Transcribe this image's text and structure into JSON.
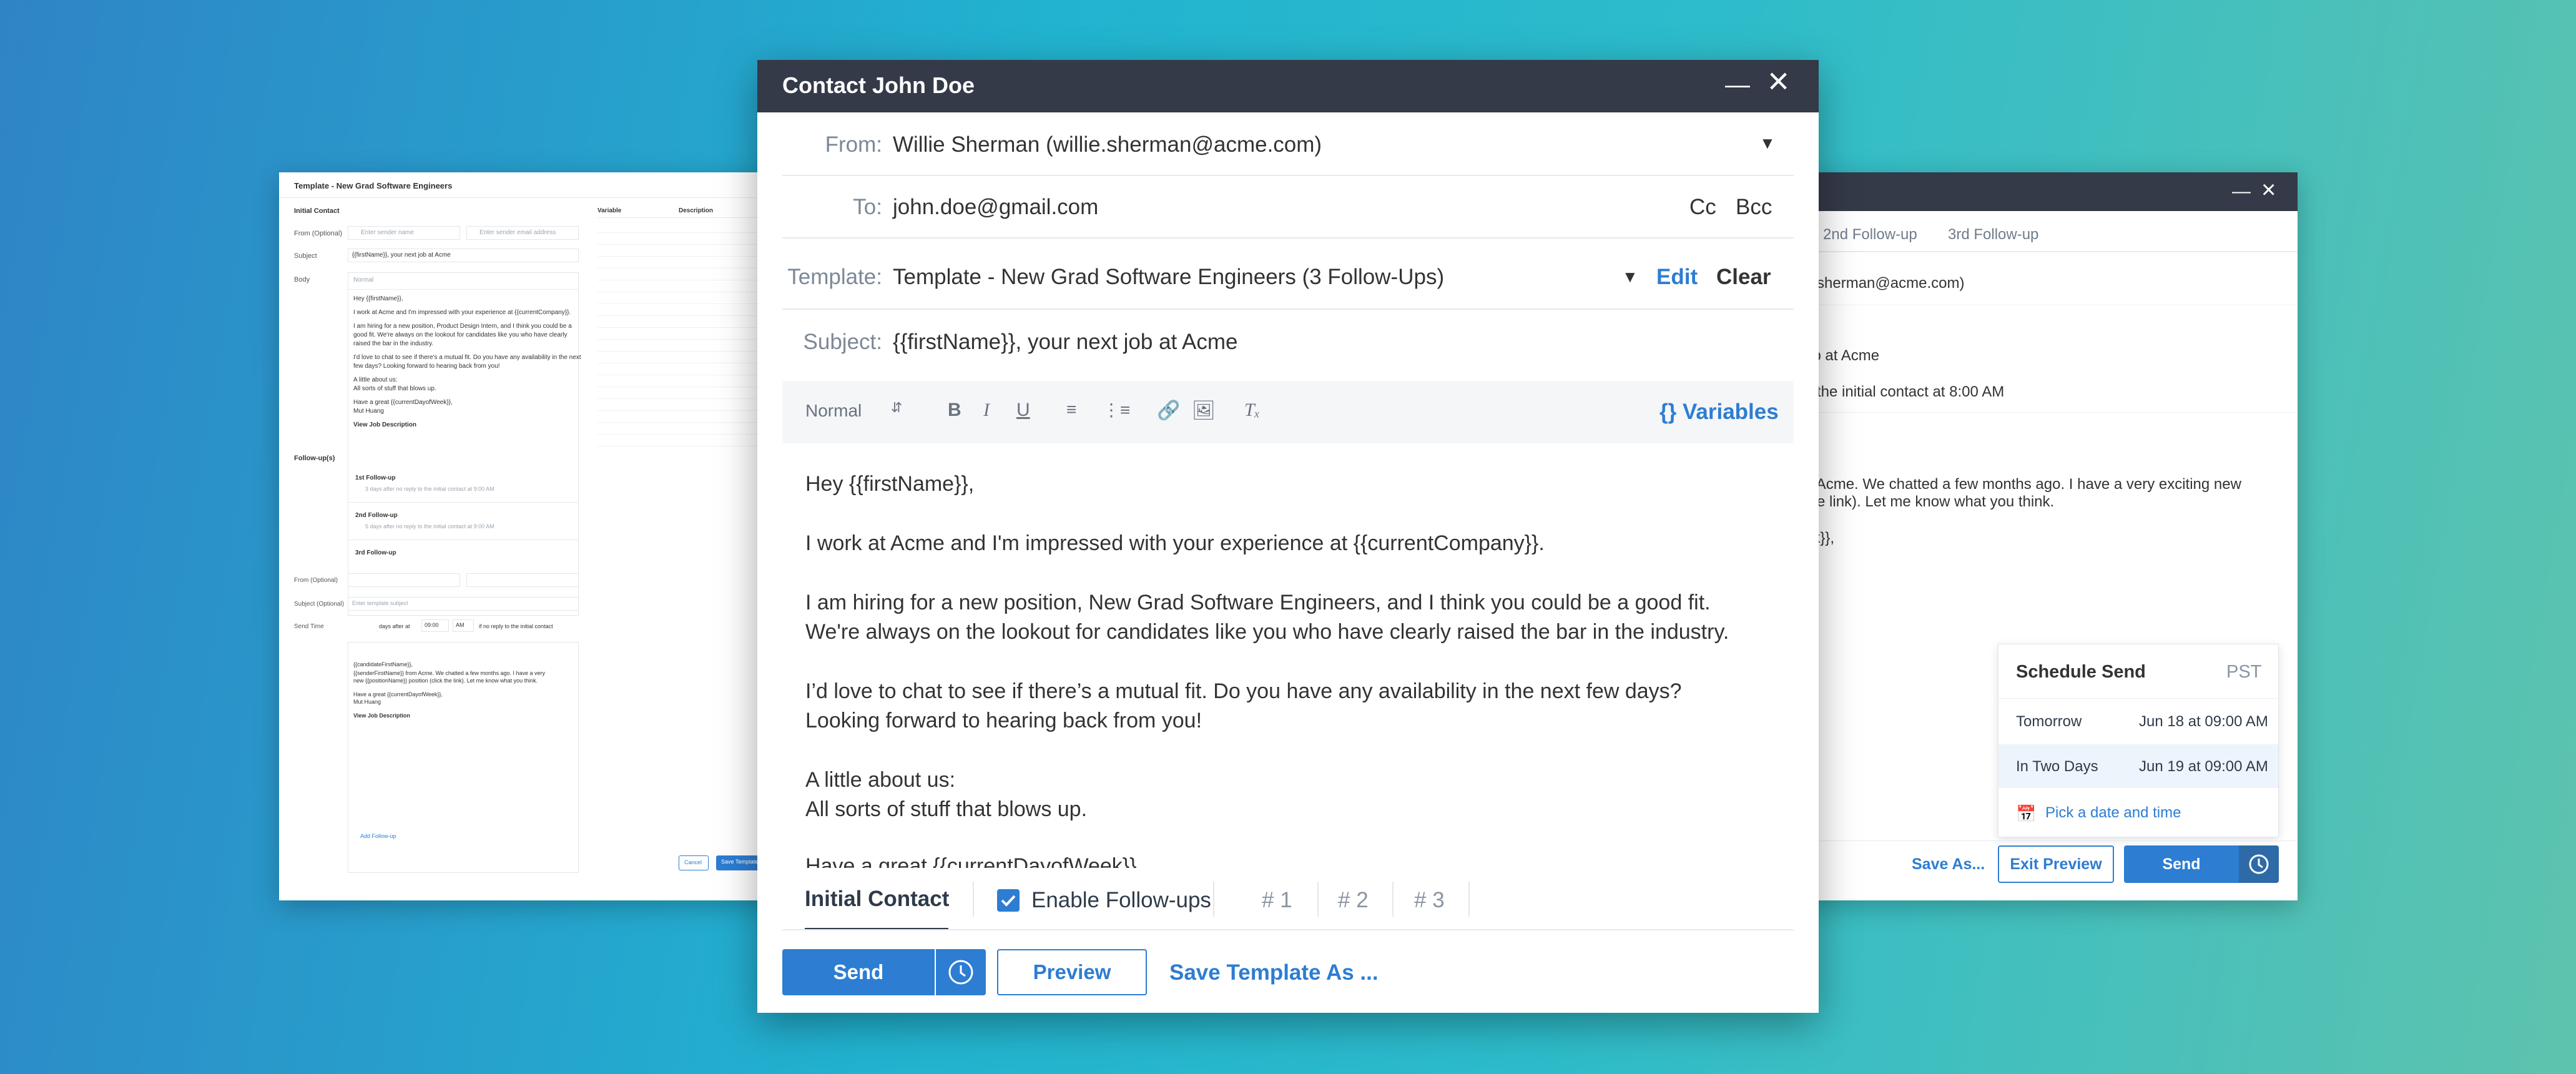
{
  "template_window": {
    "title": "Template - New Grad Software Engineers",
    "initial_contact": "Initial Contact",
    "from_label": "From (Optional)",
    "from_placeholder": "Enter sender name",
    "from_email_placeholder": "Enter sender email address",
    "subject_label": "Subject",
    "subject_value": "{{firstName}}, your next job at Acme",
    "body_label": "Body",
    "body_format": "Normal",
    "body_lines": [
      "Hey {{firstName}},",
      "I work at Acme and I'm impressed with your experience at {{currentCompany}}.",
      "I am hiring for a new position, Product Design Intern, and I think you could be a",
      "good fit. We're always on the lookout for candidates like you who have clearly",
      "raised the bar in the industry.",
      "I'd love to chat to see if there's a mutual fit. Do you have any availability in the next",
      "few days? Looking forward to hearing back from you!",
      "A little about us:",
      "All sorts of stuff that blows up.",
      "Have a great {{currentDayofWeek}},",
      "Mut Huang",
      "View Job Description"
    ],
    "variables_header": "Variable",
    "description_header": "Description",
    "followups_label": "Follow-up(s)",
    "followups": [
      {
        "name": "1st Follow-up",
        "detail": "3 days after no reply to the initial contact at 9:00 AM"
      },
      {
        "name": "2nd Follow-up",
        "detail": "5 days after no reply to the initial contact at 9:00 AM"
      },
      {
        "name": "3rd Follow-up",
        "detail": ""
      }
    ],
    "subject_optional_label": "Subject (Optional)",
    "subject_optional_placeholder": "Enter template subject",
    "send_time_label": "Send Time",
    "send_time_days": "days after at",
    "send_time_hour": "09:00",
    "send_time_ampm": "AM",
    "send_time_suffix": "if no reply to the initial contact",
    "followup_body_lines": [
      "{{candidateFirstName}},",
      "{{senderFirstName}} from Acme. We chatted a few months ago. I have a very",
      "new {{positionName}} position (click the link). Let me know what you think.",
      "Have a great {{currentDayofWeek}},",
      "Mut Huang",
      "View Job Description"
    ],
    "add_followup": "Add Follow-up",
    "cancel": "Cancel",
    "save": "Save Template"
  },
  "preview_window": {
    "tabs": [
      "2nd Follow-up",
      "3rd Follow-up"
    ],
    "lines": [
      "e.sherman@acme.com)",
      "ob at Acme",
      "o the initial contact at 8:00 AM",
      "n Acme. We chatted a few months ago.  I have a very exciting new",
      " the link).  Let me know what you think.",
      "ek}},"
    ],
    "schedule": {
      "title": "Schedule Send",
      "tz": "PST",
      "options": [
        {
          "label": "Tomorrow",
          "when": "Jun 18 at 09:00 AM"
        },
        {
          "label": "In Two Days",
          "when": "Jun 19 at 09:00 AM"
        }
      ],
      "pick": "Pick a date and time"
    },
    "save_as": "Save As...",
    "exit_preview": "Exit Preview",
    "send": "Send"
  },
  "compose": {
    "title": "Contact John Doe",
    "from_label": "From:",
    "from_value": "Willie Sherman (willie.sherman@acme.com)",
    "to_label": "To:",
    "to_value": "john.doe@gmail.com",
    "cc": "Cc",
    "bcc": "Bcc",
    "template_label": "Template:",
    "template_value": "Template - New Grad Software Engineers (3 Follow-Ups)",
    "edit": "Edit",
    "clear": "Clear",
    "subject_label": "Subject:",
    "subject_value": "{{firstName}}, your next job at Acme",
    "format": "Normal",
    "variables": "{} Variables",
    "body_lines": [
      "Hey {{firstName}},",
      "I work at Acme and I'm impressed with your experience at {{currentCompany}}.",
      "I am hiring for a new position, New Grad Software Engineers, and I think you could be a good fit.",
      "We're always on the lookout for candidates like you who have clearly raised the bar in the industry.",
      "I’d love to chat to see if there’s a mutual fit. Do you have any availability in the next few days?",
      "Looking forward to hearing back from you!",
      "A little about us:",
      "All sorts of stuff that blows up.",
      "Have a great {{currentDayofWeek}},"
    ],
    "tab_initial": "Initial Contact",
    "enable_followups": "Enable Follow-ups",
    "followup_tabs": [
      "# 1",
      "# 2",
      "# 3"
    ],
    "send": "Send",
    "preview": "Preview",
    "save_template_as": "Save Template As ..."
  },
  "colors": {
    "accent": "#2d7dd2",
    "titlebar": "#343a48",
    "bg_start": "#2f84c6",
    "bg_end": "#5ec3ae"
  }
}
